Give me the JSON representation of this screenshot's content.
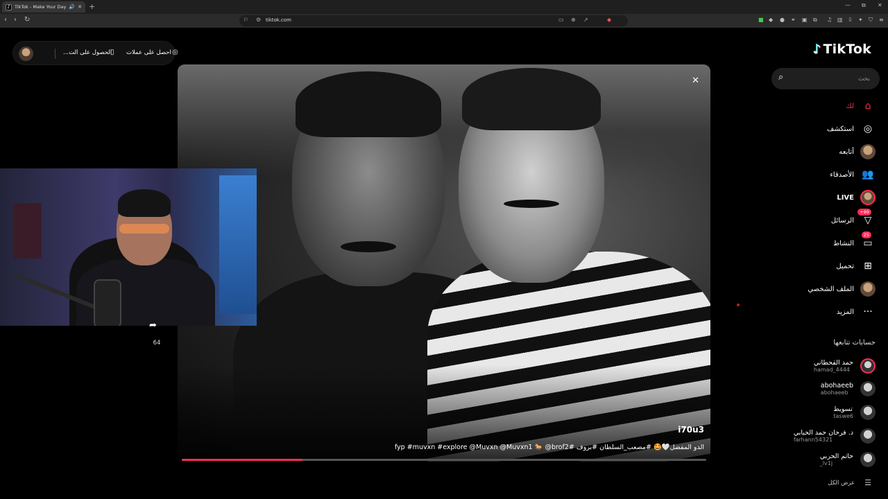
{
  "browser": {
    "tab_title": "TikTok - Make Your Day",
    "tab_close": "✕",
    "new_tab": "+",
    "url": "tiktok.com",
    "window_controls": [
      "—",
      "⧉",
      "✕"
    ],
    "nav": {
      "back": "‹",
      "forward": "›",
      "reload": "↻"
    }
  },
  "top_pill": {
    "coins_label": "احصل على عملات",
    "get_app_label": "الحصول على الت..."
  },
  "video": {
    "author": "i70u3",
    "caption": "الدو المفضل🤍🤩 #مصعب_السلطان #بروف #fyp #muvxn #explore @Muvxn @Muvxn1 🐎 @brof2",
    "progress": 0.23,
    "close_icon": "✕"
  },
  "share": {
    "count": "64"
  },
  "sidebar": {
    "logo": "TikTok",
    "search_placeholder": "بحث",
    "nav": [
      {
        "label": "لك",
        "icon": "⌂"
      },
      {
        "label": "استكشف",
        "icon": "◎"
      },
      {
        "label": "أتابعه",
        "icon": ""
      },
      {
        "label": "الأصدقاء",
        "icon": "👥"
      },
      {
        "label": "LIVE",
        "icon": ""
      },
      {
        "label": "الرسائل",
        "icon": "▽",
        "badge": "+99"
      },
      {
        "label": "النشاط",
        "icon": "▭",
        "badge": "25"
      },
      {
        "label": "تحميل",
        "icon": "⊞"
      },
      {
        "label": "الملف الشخصي",
        "icon": ""
      },
      {
        "label": "المزيد",
        "icon": "···"
      }
    ],
    "following_title": "حسابات تتابعها",
    "accounts": [
      {
        "name": "حمد القحطاني",
        "user": "hamad_4444"
      },
      {
        "name": "abohaeeb",
        "user": "abohaeeb"
      },
      {
        "name": "تسويط",
        "user": "taswe6"
      },
      {
        "name": "د. فرحان حمد الحبابي",
        "user": "farhann54321"
      },
      {
        "name": "حاتم الحربي",
        "user": "_lv1j"
      }
    ],
    "see_all": "عرض الكل"
  },
  "colors": {
    "accent": "#fe2c55",
    "background": "#000000",
    "cyan": "#25f4ee"
  }
}
